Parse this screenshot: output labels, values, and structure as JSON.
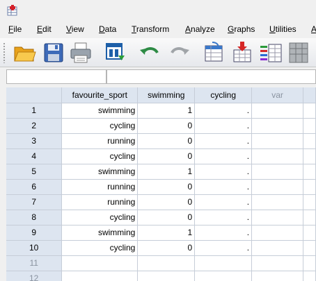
{
  "menu": {
    "items": [
      {
        "pre": "",
        "u": "F",
        "post": "ile"
      },
      {
        "pre": "",
        "u": "E",
        "post": "dit"
      },
      {
        "pre": "",
        "u": "V",
        "post": "iew"
      },
      {
        "pre": "",
        "u": "D",
        "post": "ata"
      },
      {
        "pre": "",
        "u": "T",
        "post": "ransform"
      },
      {
        "pre": "",
        "u": "A",
        "post": "nalyze"
      },
      {
        "pre": "",
        "u": "G",
        "post": "raphs"
      },
      {
        "pre": "",
        "u": "U",
        "post": "tilities"
      },
      {
        "pre": "",
        "u": "A",
        "post": ""
      }
    ]
  },
  "toolbar": {
    "icons": [
      "open-folder-icon",
      "save-icon",
      "print-icon",
      "dialog-recall-icon",
      "undo-icon",
      "redo-icon",
      "goto-case-icon",
      "goto-variable-icon",
      "variables-icon",
      "find-icon"
    ]
  },
  "grid": {
    "columns": [
      "favourite_sport",
      "swimming",
      "cycling",
      "var"
    ],
    "rows": [
      {
        "n": "1",
        "sport": "swimming",
        "swim": "1",
        "cyc": "."
      },
      {
        "n": "2",
        "sport": "cycling",
        "swim": "0",
        "cyc": "."
      },
      {
        "n": "3",
        "sport": "running",
        "swim": "0",
        "cyc": "."
      },
      {
        "n": "4",
        "sport": "cycling",
        "swim": "0",
        "cyc": "."
      },
      {
        "n": "5",
        "sport": "swimming",
        "swim": "1",
        "cyc": "."
      },
      {
        "n": "6",
        "sport": "running",
        "swim": "0",
        "cyc": "."
      },
      {
        "n": "7",
        "sport": "running",
        "swim": "0",
        "cyc": "."
      },
      {
        "n": "8",
        "sport": "cycling",
        "swim": "0",
        "cyc": "."
      },
      {
        "n": "9",
        "sport": "swimming",
        "swim": "1",
        "cyc": "."
      },
      {
        "n": "10",
        "sport": "cycling",
        "swim": "0",
        "cyc": "."
      }
    ],
    "empty_rows": [
      "11",
      "12"
    ]
  },
  "colors": {
    "header_bg": "#dde5f0",
    "grid_line": "#c6cdd8",
    "inactive_text": "#8a93a0"
  }
}
